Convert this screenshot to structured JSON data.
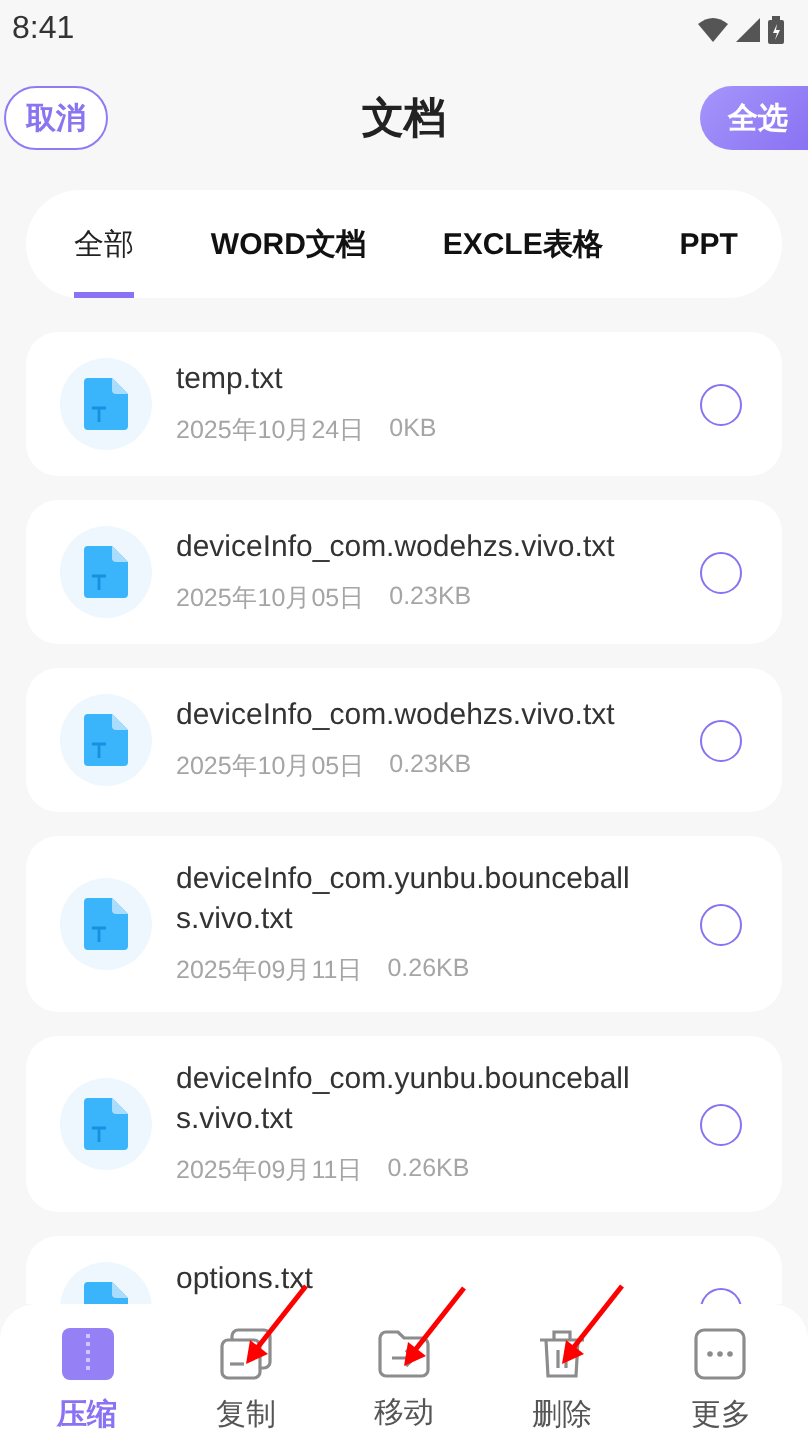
{
  "status_bar": {
    "time": "8:41"
  },
  "header": {
    "cancel": "取消",
    "title": "文档",
    "select_all": "全选"
  },
  "tabs": [
    {
      "label": "全部",
      "selected": true
    },
    {
      "label": "WORD文档",
      "selected": false
    },
    {
      "label": "EXCLE表格",
      "selected": false
    },
    {
      "label": "PPT",
      "selected": false
    }
  ],
  "files": [
    {
      "name": "temp.txt",
      "date": "2025年10月24日",
      "size": "0KB",
      "checked": false
    },
    {
      "name": "deviceInfo_com.wodehzs.vivo.txt",
      "date": "2025年10月05日",
      "size": "0.23KB",
      "checked": false
    },
    {
      "name": "deviceInfo_com.wodehzs.vivo.txt",
      "date": "2025年10月05日",
      "size": "0.23KB",
      "checked": false
    },
    {
      "name": "deviceInfo_com.yunbu.bounceballs.vivo.txt",
      "date": "2025年09月11日",
      "size": "0.26KB",
      "checked": false
    },
    {
      "name": "deviceInfo_com.yunbu.bounceballs.vivo.txt",
      "date": "2025年09月11日",
      "size": "0.26KB",
      "checked": false
    },
    {
      "name": "options.txt",
      "checked": false
    }
  ],
  "bottom_nav": [
    {
      "kind": "compress",
      "label": "压缩",
      "selected": true,
      "marked": false
    },
    {
      "kind": "copy",
      "label": "复制",
      "selected": false,
      "marked": true
    },
    {
      "kind": "move",
      "label": "移动",
      "selected": false,
      "marked": true
    },
    {
      "kind": "delete",
      "label": "删除",
      "selected": false,
      "marked": true
    },
    {
      "kind": "more",
      "label": "更多",
      "selected": false,
      "marked": false
    }
  ]
}
